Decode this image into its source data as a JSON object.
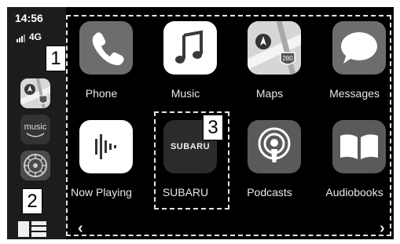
{
  "status": {
    "time": "14:56",
    "network": "4G"
  },
  "sidebar": {
    "music_icon_text": "music",
    "items": [
      "maps-shortcut",
      "amazon-music-shortcut",
      "settings-shortcut"
    ]
  },
  "apps": [
    {
      "label": "Phone",
      "icon": "phone-icon",
      "color": "#6d6d6d"
    },
    {
      "label": "Music",
      "icon": "music-note-icon",
      "color": "#ffffff"
    },
    {
      "label": "Maps",
      "icon": "maps-icon",
      "color": "#cfcfcf"
    },
    {
      "label": "Messages",
      "icon": "speech-bubble-icon",
      "color": "#6d6d6d"
    },
    {
      "label": "Now Playing",
      "icon": "waveform-icon",
      "color": "#ffffff"
    },
    {
      "label": "SUBARU",
      "icon": "subaru-logo-icon",
      "color": "#2b2b2b",
      "logo_text": "SUBARU"
    },
    {
      "label": "Podcasts",
      "icon": "podcast-icon",
      "color": "#5a5a5a"
    },
    {
      "label": "Audiobooks",
      "icon": "open-book-icon",
      "color": "#5a5a5a"
    }
  ],
  "maps_shield": "280",
  "callouts": [
    "1",
    "2",
    "3"
  ]
}
